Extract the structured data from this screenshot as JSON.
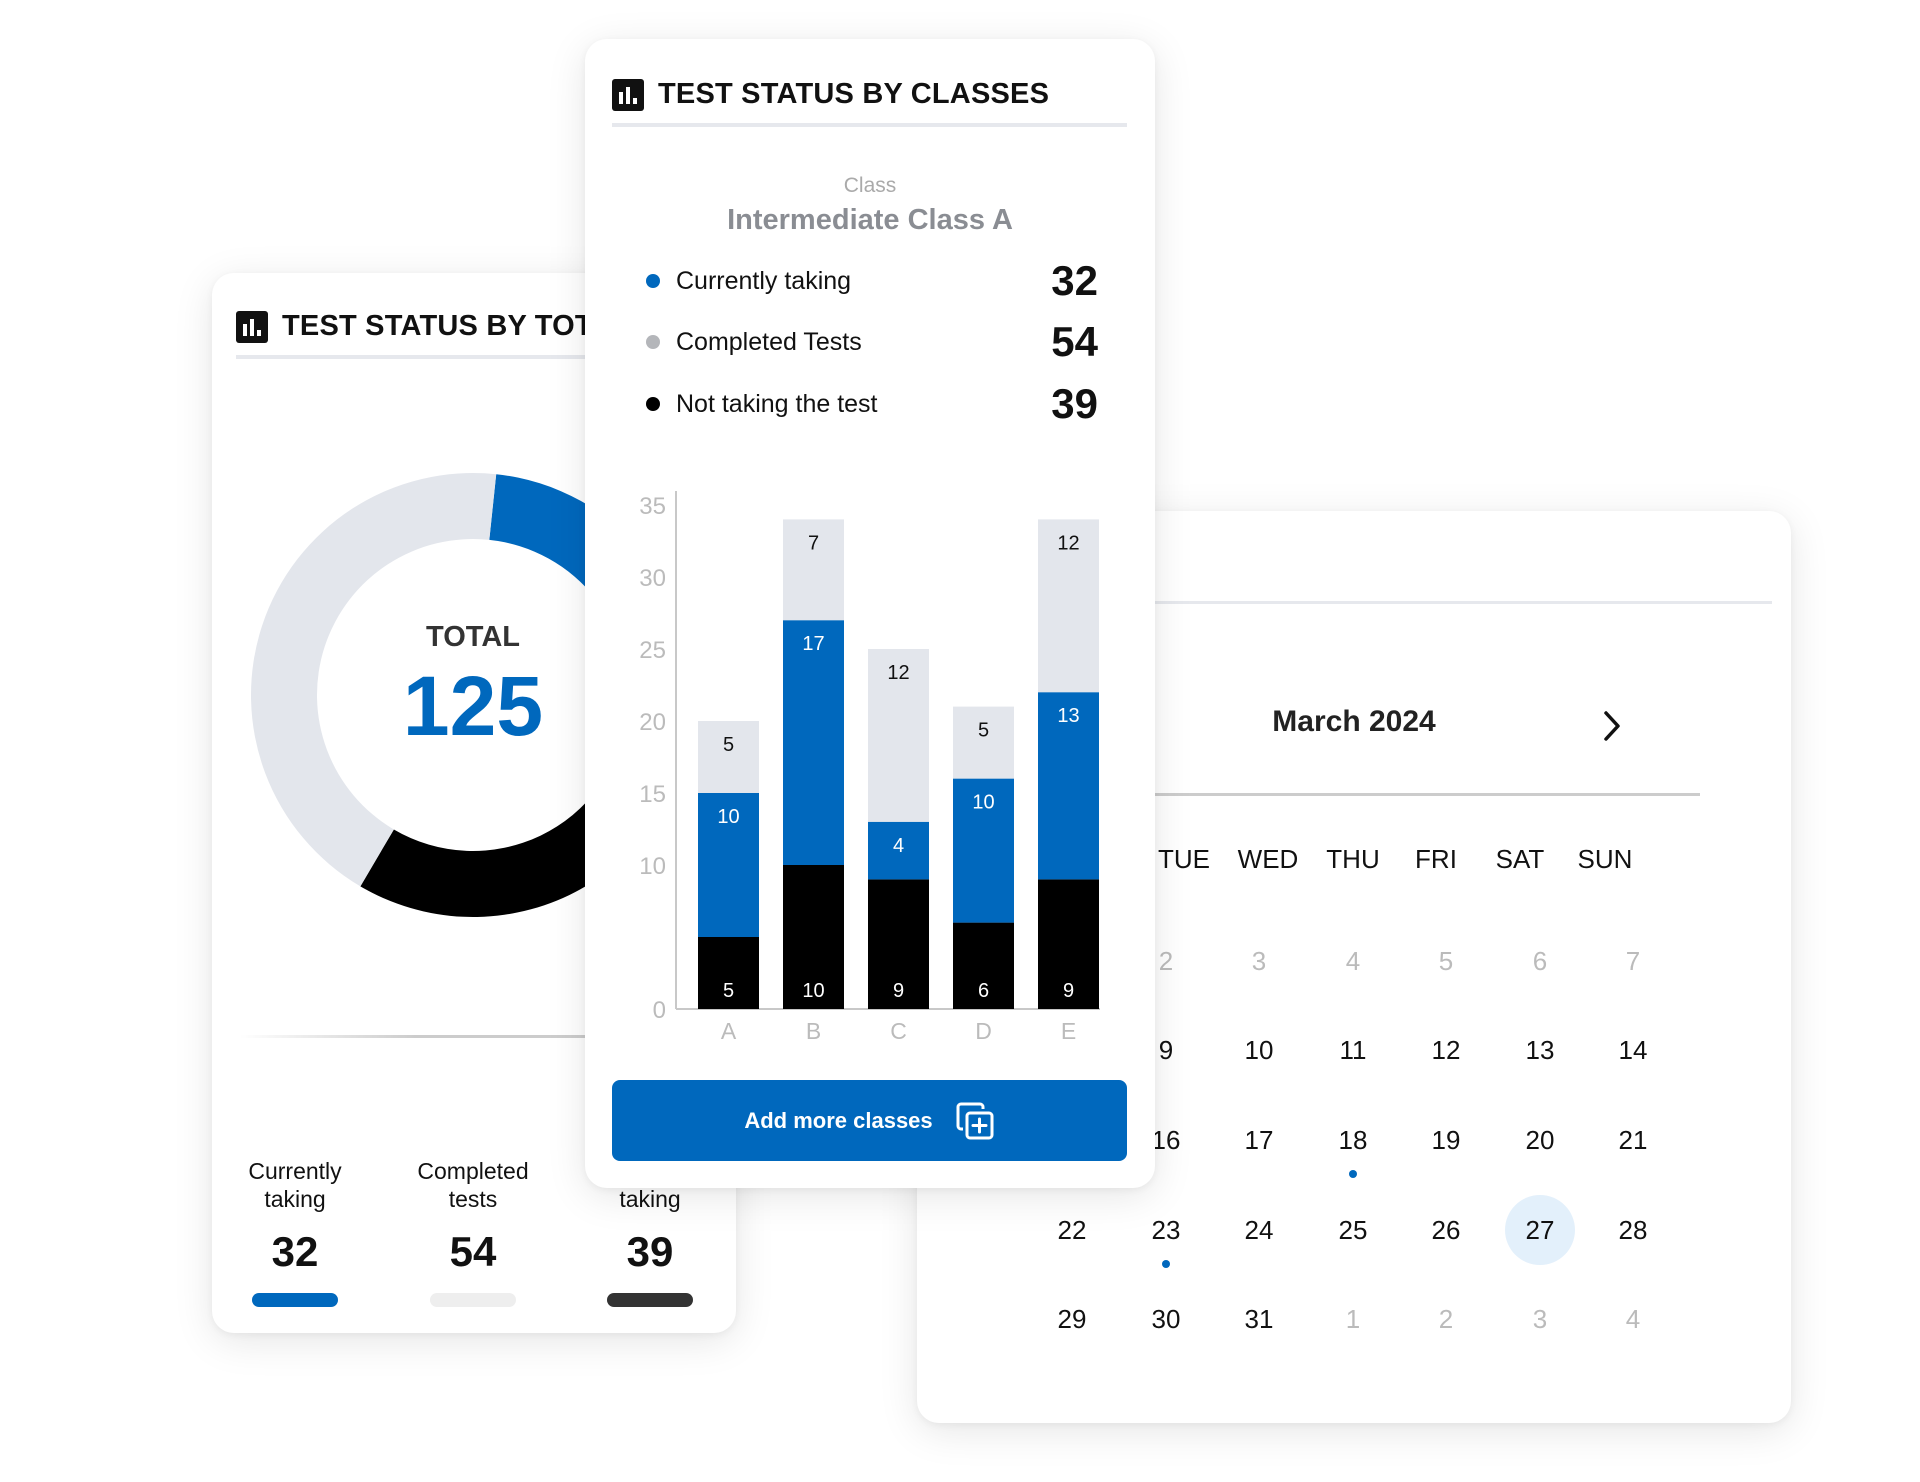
{
  "colors": {
    "blue": "#0068BD",
    "gray": "#E3E6EC",
    "black": "#000000",
    "legend_gray": "#B4B6BA",
    "selected_day": "#E3F0FB"
  },
  "total_card": {
    "title": "TEST STATUS BY TOTAL",
    "icon": "bar-chart-icon",
    "center_label": "TOTAL",
    "center_value": "125",
    "donut": [
      {
        "key": "currently",
        "value": 32,
        "color": "#0068BD"
      },
      {
        "key": "not_taking",
        "value": 39,
        "color": "#000000"
      },
      {
        "key": "completed",
        "value": 54,
        "color": "#E3E6EC"
      }
    ],
    "stats": [
      {
        "line1": "Currently",
        "line2": "taking",
        "value": "32",
        "color": "#0068BD"
      },
      {
        "line1": "Completed",
        "line2": "tests",
        "value": "54",
        "color": "#EEEEEE"
      },
      {
        "line1": "",
        "line2": "taking",
        "value": "39",
        "color": "#333333"
      }
    ]
  },
  "classes_card": {
    "title": "TEST STATUS BY CLASSES",
    "icon": "bar-chart-icon",
    "class_label": "Class",
    "class_name": "Intermediate Class A",
    "legend": [
      {
        "label": "Currently taking",
        "value": "32",
        "color": "#0068BD"
      },
      {
        "label": "Completed Tests",
        "value": "54",
        "color": "#B4B6BA"
      },
      {
        "label": "Not taking the test",
        "value": "39",
        "color": "#000000"
      }
    ],
    "button": {
      "label": "Add more classes",
      "icon": "copy-plus-icon"
    }
  },
  "chart_data": {
    "type": "bar",
    "stacked": true,
    "categories": [
      "A",
      "B",
      "C",
      "D",
      "E"
    ],
    "series": [
      {
        "key": "not_taking",
        "values": [
          5,
          10,
          9,
          6,
          9
        ],
        "color": "#000000",
        "label_color": "#ffffff"
      },
      {
        "key": "currently",
        "values": [
          10,
          17,
          4,
          10,
          13
        ],
        "color": "#0068BD",
        "label_color": "#ffffff"
      },
      {
        "key": "completed",
        "values": [
          5,
          7,
          12,
          5,
          12
        ],
        "color": "#E3E6EC",
        "label_color": "#111111"
      }
    ],
    "yticks": [
      0,
      10,
      15,
      20,
      25,
      30,
      35
    ],
    "ylim": [
      0,
      35
    ],
    "grid": false
  },
  "calendar": {
    "month": "March 2024",
    "next_icon": "chevron-right-icon",
    "weekdays": [
      "TUE",
      "WED",
      "THU",
      "FRI",
      "SAT",
      "SUN"
    ],
    "weeks": [
      [
        null,
        {
          "d": "2",
          "dim": true
        },
        {
          "d": "3",
          "dim": true
        },
        {
          "d": "4",
          "dim": true
        },
        {
          "d": "5",
          "dim": true
        },
        {
          "d": "6",
          "dim": true
        },
        {
          "d": "7",
          "dim": true
        }
      ],
      [
        null,
        {
          "d": "9"
        },
        {
          "d": "10"
        },
        {
          "d": "11"
        },
        {
          "d": "12"
        },
        {
          "d": "13"
        },
        {
          "d": "14"
        }
      ],
      [
        null,
        {
          "d": "16"
        },
        {
          "d": "17"
        },
        {
          "d": "18",
          "event": true
        },
        {
          "d": "19"
        },
        {
          "d": "20"
        },
        {
          "d": "21"
        }
      ],
      [
        {
          "d": "22"
        },
        {
          "d": "23",
          "event": true
        },
        {
          "d": "24"
        },
        {
          "d": "25"
        },
        {
          "d": "26"
        },
        {
          "d": "27",
          "selected": true
        },
        {
          "d": "28"
        }
      ],
      [
        {
          "d": "29"
        },
        {
          "d": "30"
        },
        {
          "d": "31"
        },
        {
          "d": "1",
          "dim": true
        },
        {
          "d": "2",
          "dim": true
        },
        {
          "d": "3",
          "dim": true
        },
        {
          "d": "4",
          "dim": true
        }
      ]
    ]
  }
}
